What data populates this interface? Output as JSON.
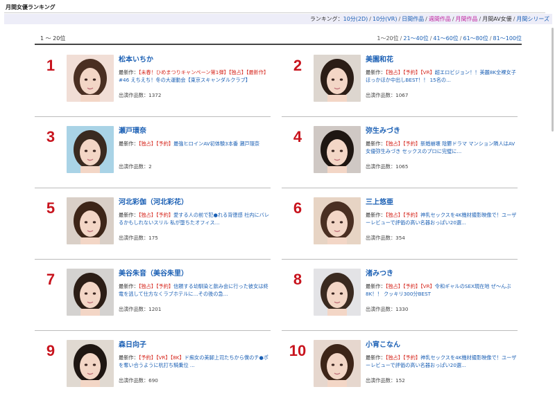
{
  "page_title": "月間女優ランキング",
  "ranking_nav": {
    "label": "ランキング：",
    "links": [
      {
        "label": "10分(2D)",
        "state": "link"
      },
      {
        "label": "10分(VR)",
        "state": "link"
      },
      {
        "label": "日間作品",
        "state": "link"
      },
      {
        "label": "週間作品",
        "state": "active"
      },
      {
        "label": "月間作品",
        "state": "active"
      },
      {
        "label": "月間AV女優",
        "state": "current"
      },
      {
        "label": "月間シリーズ",
        "state": "link"
      }
    ]
  },
  "range": {
    "label": "1 〜 20位",
    "pages": [
      {
        "label": "1〜20位",
        "state": "current"
      },
      {
        "label": "21〜40位",
        "state": "link"
      },
      {
        "label": "41〜60位",
        "state": "link"
      },
      {
        "label": "61〜80位",
        "state": "link"
      },
      {
        "label": "81〜100位",
        "state": "link"
      }
    ]
  },
  "labels": {
    "latest_prefix": "最新作：",
    "count_prefix": "出演作品数："
  },
  "actresses": [
    {
      "rank": "1",
      "name": "松本いちか",
      "photo_bg": "#f1ded6",
      "latest_parts": [
        {
          "t": "【未春！ひめまつりキャンペーン第1弾】【独占】【最新作】",
          "tag": true
        },
        {
          "t": "#46 えちえち！冬の大運動会【東京スキャンダルクラブ】",
          "tag": false
        }
      ],
      "count": "1372"
    },
    {
      "rank": "2",
      "name": "美園和花",
      "photo_bg": "#ddd6cf",
      "latest_parts": [
        {
          "t": "【独占】【予約】【VR】",
          "tag": true
        },
        {
          "t": "超エロビジョン！！美麗8K全裸女子ほっかほか中出しBEST！！ 15名の...",
          "tag": false
        }
      ],
      "count": "1067"
    },
    {
      "rank": "3",
      "name": "瀬戸環奈",
      "photo_bg": "#a9d3e6",
      "latest_parts": [
        {
          "t": "【独占】【予約】",
          "tag": true
        },
        {
          "t": "最強ヒロインAV初体験3本番 瀬戸環奈",
          "tag": false
        }
      ],
      "count": "2"
    },
    {
      "rank": "4",
      "name": "弥生みづき",
      "photo_bg": "#cfc8c4",
      "latest_parts": [
        {
          "t": "【独占】【予約】",
          "tag": true
        },
        {
          "t": "新婚崩壊 陰鬱ドラマ マンション隣人はAV女優弥生みづき セックスのプロに完璧に...",
          "tag": false
        }
      ],
      "count": "1065"
    },
    {
      "rank": "5",
      "name": "河北彩伽（河北彩花）",
      "photo_bg": "#d9cfc7",
      "latest_parts": [
        {
          "t": "【独占】【予約】",
          "tag": true
        },
        {
          "t": "愛する人の前で犯●れる背徳感 社内にバレるかもしれないスリル 私が堕ちたオフィス...",
          "tag": false
        }
      ],
      "count": "175"
    },
    {
      "rank": "6",
      "name": "三上悠亜",
      "photo_bg": "#e7d4c4",
      "latest_parts": [
        {
          "t": "【独占】【予約】",
          "tag": true
        },
        {
          "t": "神乳セックスを4K機材撮影映像で！ユーザーレビューで評価の高い名器おっぱい20選...",
          "tag": false
        }
      ],
      "count": "354"
    },
    {
      "rank": "7",
      "name": "美谷朱音（美谷朱里）",
      "photo_bg": "#d4d2d0",
      "latest_parts": [
        {
          "t": "【独占】【予約】",
          "tag": true
        },
        {
          "t": "信頼する幼馴染と飲み会に行った彼女は終電を逃して仕方なくラブホテルに…その後の急...",
          "tag": false
        }
      ],
      "count": "1201"
    },
    {
      "rank": "8",
      "name": "渚みつき",
      "photo_bg": "#e3e3e6",
      "latest_parts": [
        {
          "t": "【独占】【予約】【VR】",
          "tag": true
        },
        {
          "t": "令和ギャルのSEX現在地 ぜ〜んぶ8K！！ クッキリ300分BEST",
          "tag": false
        }
      ],
      "count": "1330"
    },
    {
      "rank": "9",
      "name": "森日向子",
      "photo_bg": "#e0d9d1",
      "latest_parts": [
        {
          "t": "【予約】【VR】【8K】",
          "tag": true
        },
        {
          "t": "ド痴女の美脚上司たちから僕のチ●ポを奪い合うように杭打ち騎乗位 ...",
          "tag": false
        }
      ],
      "count": "690"
    },
    {
      "rank": "10",
      "name": "小宵こなん",
      "photo_bg": "#e6d7ce",
      "latest_parts": [
        {
          "t": "【独占】【予約】",
          "tag": true
        },
        {
          "t": "神乳セックスを4K機材撮影映像で！ユーザーレビューで評価の高い名器おっぱい20選...",
          "tag": false
        }
      ],
      "count": "152"
    }
  ]
}
